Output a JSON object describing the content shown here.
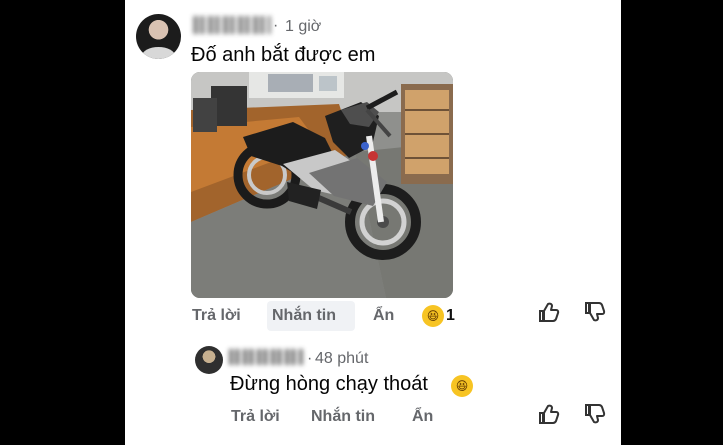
{
  "comments": [
    {
      "time": "1 giờ",
      "text": "Đố anh bắt được em",
      "actions": {
        "reply": "Trả lời",
        "message": "Nhắn tin",
        "hide": "Ẩn"
      },
      "reaction_count": "1"
    },
    {
      "time": "48 phút",
      "text": "Đừng hòng chạy thoát",
      "actions": {
        "reply": "Trả lời",
        "message": "Nhắn tin",
        "hide": "Ẩn"
      }
    }
  ],
  "colors": {
    "text": "#050505",
    "meta": "#65676b",
    "chip": "#f0f2f5",
    "reaction": "#f7c423"
  },
  "icons": [
    "like-icon",
    "dislike-icon",
    "laughing-emoji-icon"
  ]
}
